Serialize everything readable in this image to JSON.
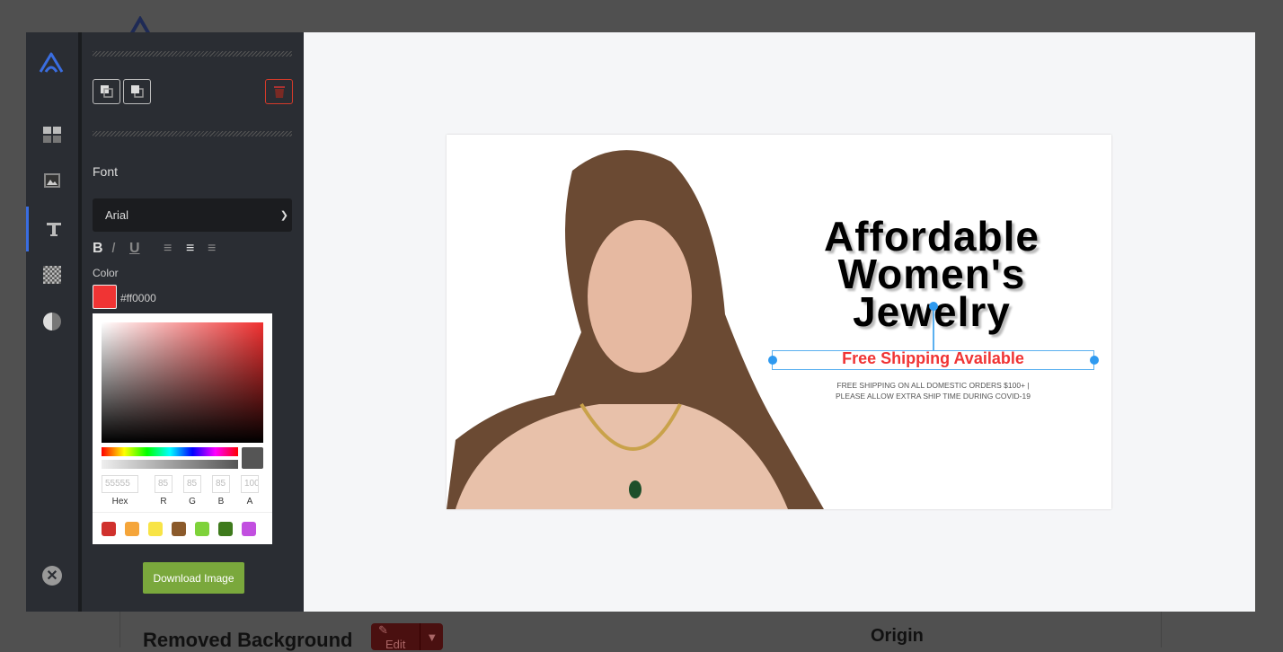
{
  "background": {
    "section_title": "Removed Background",
    "edit_label": "Edit",
    "origin_title": "Origin"
  },
  "rail": {
    "items": [
      {
        "icon": "layout-icon"
      },
      {
        "icon": "image-icon"
      },
      {
        "icon": "text-icon",
        "active": true
      },
      {
        "icon": "transparency-icon"
      },
      {
        "icon": "contrast-icon"
      }
    ],
    "close_icon": "close-icon"
  },
  "panel": {
    "font_label": "Font",
    "font_value": "Arial",
    "color_label": "Color",
    "color_value": "#ff0000",
    "picker": {
      "hex": "55555",
      "r": "85",
      "g": "85",
      "b": "85",
      "a": "100",
      "labels": {
        "hex": "Hex",
        "r": "R",
        "g": "G",
        "b": "B",
        "a": "A"
      },
      "presets": [
        "#d0312d",
        "#f5a53a",
        "#f8e446",
        "#8b5a2b",
        "#7ed23a",
        "#3e7a1c",
        "#c24fe0"
      ]
    },
    "download_label": "Download Image"
  },
  "canvas": {
    "headline": [
      "Affordable",
      "Women's",
      "Jewelry"
    ],
    "selected_text": "Free Shipping Available",
    "subtext": [
      "FREE SHIPPING ON ALL DOMESTIC ORDERS $100+  |",
      "PLEASE ALLOW EXTRA SHIP TIME DURING COVID-19"
    ]
  },
  "colors": {
    "accent": "#3a6de0",
    "download": "#7aa83c",
    "delete": "#d43a2a",
    "text_selected": "#f03434"
  }
}
